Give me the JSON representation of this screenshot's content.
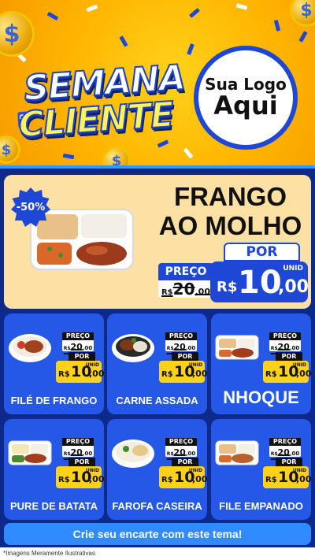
{
  "header": {
    "title_line1": "SEMANA",
    "title_small": "DO",
    "title_line2": "CLIENTE",
    "logo_line1": "Sua Logo",
    "logo_line2": "Aqui",
    "coin_symbol": "$",
    "colors": {
      "background": "#ffb400",
      "accent_blue": "#1f47d6",
      "title_yellow": "#fff35a"
    }
  },
  "featured": {
    "discount_badge": "-50%",
    "name_line1": "FRANGO",
    "name_line2": "AO MOLHO",
    "old_price": {
      "label": "PREÇO",
      "currency": "R$",
      "integer": "20",
      "decimal": ",00"
    },
    "new_price": {
      "label": "POR",
      "unit": "UNID",
      "currency": "R$",
      "integer": "10",
      "decimal": ",00"
    }
  },
  "products": [
    {
      "name": "FILÉ DE FRANGO",
      "old_label": "PREÇO",
      "old_currency": "R$",
      "old_integer": "20",
      "old_decimal": ",00",
      "por_label": "POR",
      "unit": "UNID",
      "new_currency": "R$",
      "new_integer": "10",
      "new_decimal": ",00",
      "icon": "bowl-chicken-icon"
    },
    {
      "name": "CARNE ASSADA",
      "old_label": "PREÇO",
      "old_currency": "R$",
      "old_integer": "20",
      "old_decimal": ",00",
      "por_label": "POR",
      "unit": "UNID",
      "new_currency": "R$",
      "new_integer": "10",
      "new_decimal": ",00",
      "icon": "bowl-beef-icon"
    },
    {
      "name": "NHOQUE",
      "old_label": "PREÇO",
      "old_currency": "R$",
      "old_integer": "20",
      "old_decimal": ",00",
      "por_label": "POR",
      "unit": "UNID",
      "new_currency": "R$",
      "new_integer": "10",
      "new_decimal": ",00",
      "icon": "tray-meal-icon"
    },
    {
      "name": "PURE DE BATATA",
      "old_label": "PREÇO",
      "old_currency": "R$",
      "old_integer": "20",
      "old_decimal": ",00",
      "por_label": "POR",
      "unit": "UNID",
      "new_currency": "R$",
      "new_integer": "10",
      "new_decimal": ",00",
      "icon": "tray-meal-icon"
    },
    {
      "name": "FAROFA CASEIRA",
      "old_label": "PREÇO",
      "old_currency": "R$",
      "old_integer": "20",
      "old_decimal": ",00",
      "por_label": "POR",
      "unit": "UNID",
      "new_currency": "R$",
      "new_integer": "10",
      "new_decimal": ",00",
      "icon": "bowl-rice-icon"
    },
    {
      "name": "FILE EMPANADO",
      "old_label": "PREÇO",
      "old_currency": "R$",
      "old_integer": "20",
      "old_decimal": ",00",
      "por_label": "POR",
      "unit": "UNID",
      "new_currency": "R$",
      "new_integer": "10",
      "new_decimal": ",00",
      "icon": "tray-meal-icon"
    }
  ],
  "footer": {
    "cta": "Crie seu encarte com este tema!",
    "disclaimer": "*Imagens Meramente Ilustrativas"
  }
}
